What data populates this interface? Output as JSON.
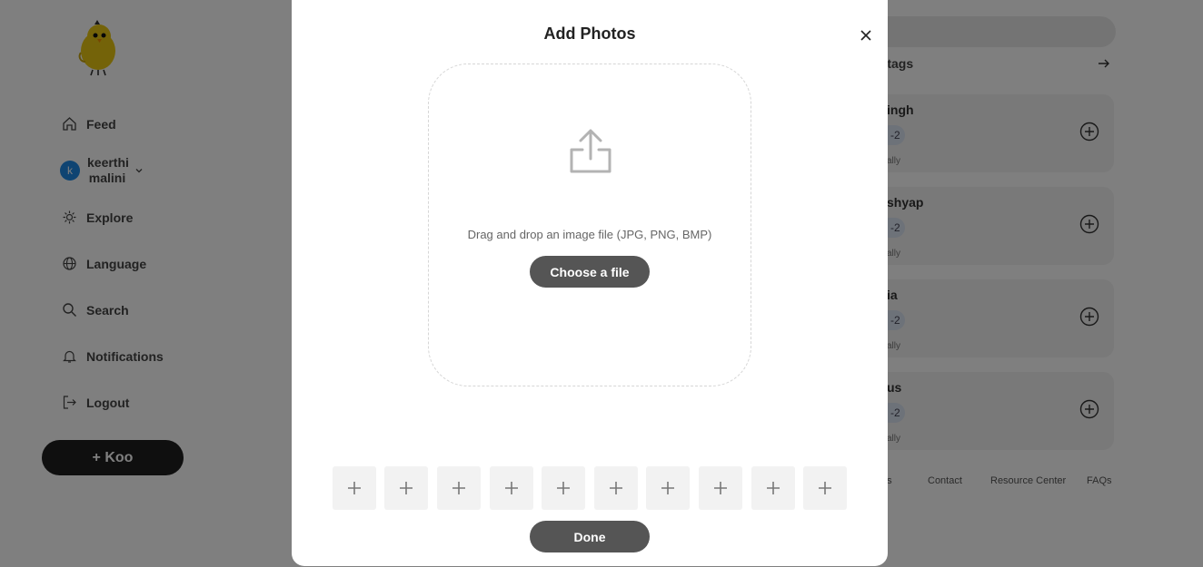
{
  "sidebar": {
    "items": [
      {
        "label": "Feed",
        "icon": "home-icon"
      },
      {
        "label": "Explore",
        "icon": "hashtag-icon"
      },
      {
        "label": "Language",
        "icon": "globe-icon"
      },
      {
        "label": "Search",
        "icon": "search-icon"
      },
      {
        "label": "Notifications",
        "icon": "bell-icon"
      },
      {
        "label": "Logout",
        "icon": "logout-icon"
      }
    ],
    "user": {
      "initial": "k",
      "name": "keerthi malini"
    },
    "koo_button": "+ Koo"
  },
  "right_panel": {
    "hashtags_label": "shtags",
    "suggestions": [
      {
        "name": "ingh",
        "pill": "-2",
        "sub": "ally"
      },
      {
        "name": "shyap",
        "pill": "-2",
        "sub": "ally"
      },
      {
        "name": "ia",
        "pill": "-2",
        "sub": "ally"
      },
      {
        "name": "us",
        "pill": "-2",
        "sub": "ally"
      }
    ],
    "footer_links": [
      "es",
      "Contact",
      "Resource Center",
      "FAQs"
    ]
  },
  "modal": {
    "title": "Add Photos",
    "drop_text": "Drag and drop an image file (JPG, PNG, BMP)",
    "choose_label": "Choose a file",
    "done_label": "Done",
    "slot_count": 10
  },
  "colors": {
    "overlay": "rgba(0,0,0,0.5)",
    "button_dark": "#555555",
    "avatar": "#1e88e5"
  }
}
